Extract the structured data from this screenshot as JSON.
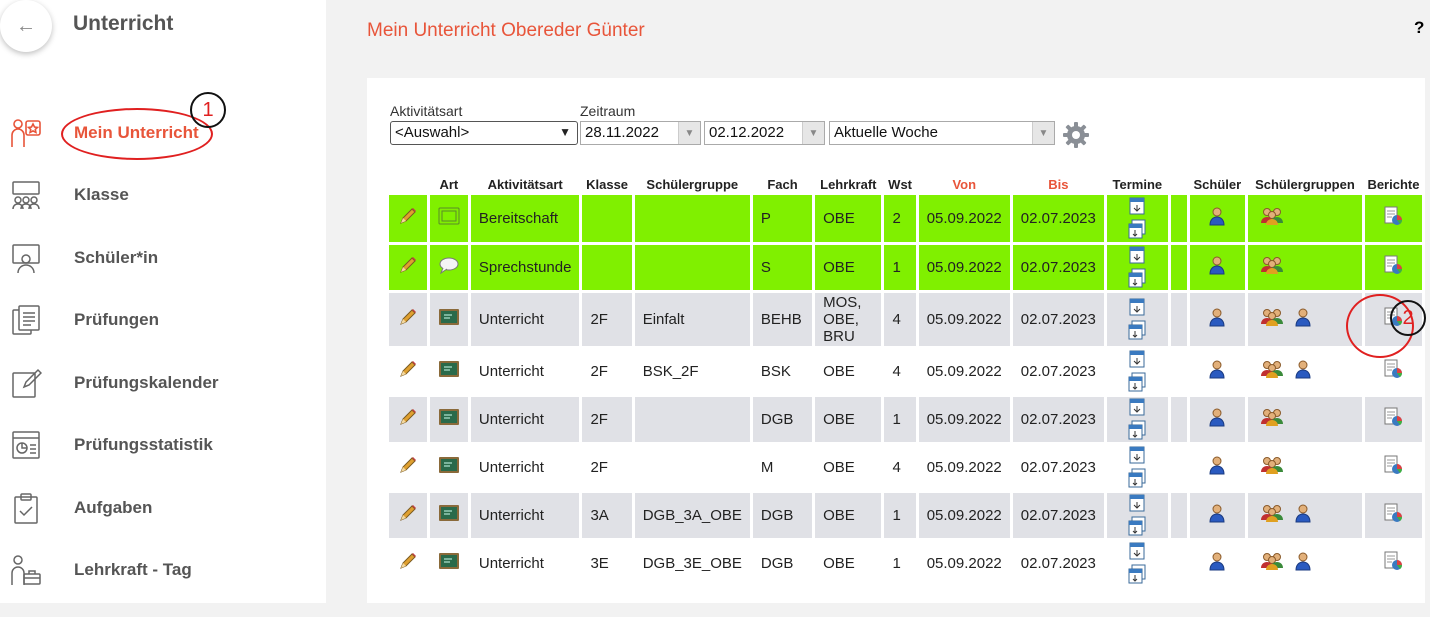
{
  "sidebar": {
    "title": "Unterricht",
    "items": [
      {
        "label": "Mein Unterricht",
        "icon": "person-star-icon",
        "active": true
      },
      {
        "label": "Klasse",
        "icon": "class-group-icon"
      },
      {
        "label": "Schüler*in",
        "icon": "student-screen-icon"
      },
      {
        "label": "Prüfungen",
        "icon": "exam-docs-icon"
      },
      {
        "label": "Prüfungskalender",
        "icon": "edit-note-icon"
      },
      {
        "label": "Prüfungsstatistik",
        "icon": "statistics-card-icon"
      },
      {
        "label": "Aufgaben",
        "icon": "clipboard-check-icon"
      },
      {
        "label": "Lehrkraft - Tag",
        "icon": "teacher-briefcase-icon"
      }
    ]
  },
  "annotations": {
    "one": "1",
    "two": "2"
  },
  "header": {
    "title": "Mein Unterricht Obereder Günter",
    "help": "?"
  },
  "filters": {
    "activity_label": "Aktivitätsart",
    "activity_value": "<Auswahl>",
    "period_label": "Zeitraum",
    "date_from": "28.11.2022",
    "date_to": "02.12.2022",
    "period_value": "Aktuelle Woche"
  },
  "table": {
    "headers": [
      "Art",
      "Aktivitätsart",
      "Klasse",
      "Schülergruppe",
      "Fach",
      "Lehrkraft",
      "Wst",
      "Von",
      "Bis",
      "Termine",
      "Schüler",
      "Schülergruppen",
      "Berichte"
    ],
    "rows": [
      {
        "type": "green",
        "art": "readiness",
        "activity": "Bereitschaft",
        "klasse": "",
        "gruppe": "",
        "fach": "P",
        "lehrkraft": "OBE",
        "wst": "2",
        "von": "05.09.2022",
        "bis": "02.07.2023",
        "extra_person": false
      },
      {
        "type": "green",
        "art": "speech",
        "activity": "Sprechstunde",
        "klasse": "",
        "gruppe": "",
        "fach": "S",
        "lehrkraft": "OBE",
        "wst": "1",
        "von": "05.09.2022",
        "bis": "02.07.2023",
        "extra_person": false
      },
      {
        "type": "grey",
        "art": "board",
        "activity": "Unterricht",
        "klasse": "2F",
        "gruppe": "Einfalt",
        "fach": "BEHB",
        "lehrkraft": "MOS,\nOBE,\nBRU",
        "wst": "4",
        "von": "05.09.2022",
        "bis": "02.07.2023",
        "extra_person": true
      },
      {
        "type": "white",
        "art": "board",
        "activity": "Unterricht",
        "klasse": "2F",
        "gruppe": "BSK_2F",
        "fach": "BSK",
        "lehrkraft": "OBE",
        "wst": "4",
        "von": "05.09.2022",
        "bis": "02.07.2023",
        "extra_person": true
      },
      {
        "type": "grey",
        "art": "board",
        "activity": "Unterricht",
        "klasse": "2F",
        "gruppe": "",
        "fach": "DGB",
        "lehrkraft": "OBE",
        "wst": "1",
        "von": "05.09.2022",
        "bis": "02.07.2023",
        "extra_person": false
      },
      {
        "type": "white",
        "art": "board",
        "activity": "Unterricht",
        "klasse": "2F",
        "gruppe": "",
        "fach": "M",
        "lehrkraft": "OBE",
        "wst": "4",
        "von": "05.09.2022",
        "bis": "02.07.2023",
        "extra_person": false
      },
      {
        "type": "grey",
        "art": "board",
        "activity": "Unterricht",
        "klasse": "3A",
        "gruppe": "DGB_3A_OBE",
        "fach": "DGB",
        "lehrkraft": "OBE",
        "wst": "1",
        "von": "05.09.2022",
        "bis": "02.07.2023",
        "extra_person": true
      },
      {
        "type": "white",
        "art": "board",
        "activity": "Unterricht",
        "klasse": "3E",
        "gruppe": "DGB_3E_OBE",
        "fach": "DGB",
        "lehrkraft": "OBE",
        "wst": "1",
        "von": "05.09.2022",
        "bis": "02.07.2023",
        "extra_person": true
      }
    ]
  },
  "colors": {
    "accent": "#e8553a",
    "row_green": "#80f000",
    "row_grey": "#e0e1e6",
    "annotation": "#e02020"
  }
}
